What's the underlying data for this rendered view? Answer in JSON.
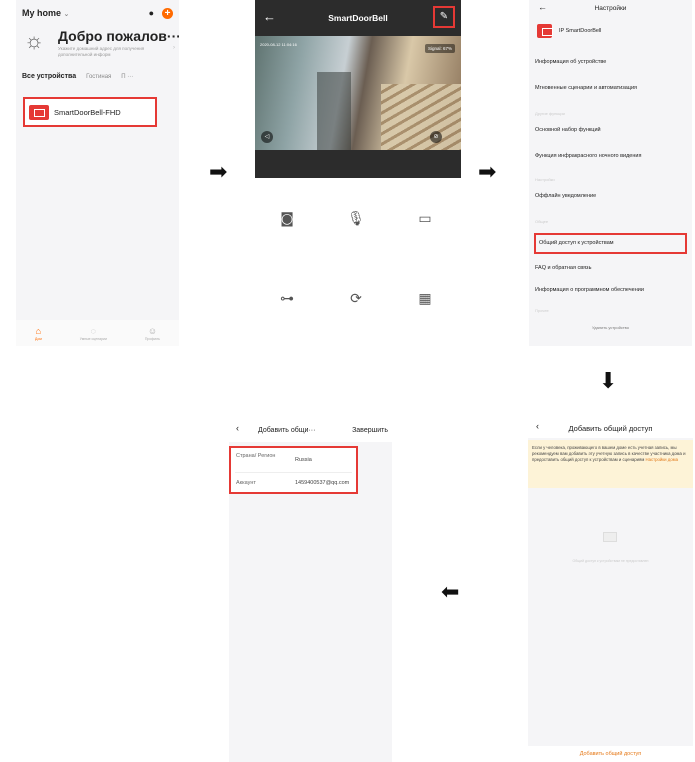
{
  "screen1": {
    "home": "My home",
    "home_chevron": "⌄",
    "mic_icon": "🎙",
    "add_icon": "+",
    "welcome": "Добро пожалов···",
    "weather_hint": "Укажите домашний адрес для получения дополнительной информ",
    "tabs": [
      "Все устройства",
      "Гостиная",
      "П ···"
    ],
    "device_name": "SmartDoorBell-FHD",
    "nav": [
      {
        "icon": "home-icon",
        "label": "Дом"
      },
      {
        "icon": "scene-icon",
        "label": "Умные сценарии"
      },
      {
        "icon": "profile-icon",
        "label": "Профиль"
      }
    ]
  },
  "screen2": {
    "title": "SmartDoorBell",
    "timestamp": "2020-08-12 11:04:16",
    "signal": "Signal: 67%"
  },
  "screen3": {
    "title": "Настройки",
    "device_name": "IP SmartDoorBell",
    "rows": [
      "Информация об устройстве",
      "Мгновенные сценарии и автоматизация",
      "Основной набор функций",
      "Функция инфракрасного ночного видения",
      "Оффлайн уведомление",
      "Общий доступ к устройствам",
      "FAQ и обратная связь",
      "Информация о программном обеспечении"
    ],
    "faint_labels": [
      "Другие функции",
      "Настройки",
      "Общее",
      "Прочее"
    ],
    "delete": "Удалить устройство"
  },
  "screen4": {
    "title": "Добавить общий доступ",
    "banner": "Если у человека, проживающего в вашем доме есть учетная запись, мы рекомендуем вам добавить эту учетную запись в качестве участника дома и предоставить общий доступ к устройствам и сценариям",
    "banner_link": "Настройки дома",
    "empty_text": "Общий доступ к устройствам не предоставлен",
    "bottom_button": "Добавить общий доступ"
  },
  "screen5": {
    "title": "Добавить общи···",
    "done": "Завершить",
    "country_label": "Страна/ Регион",
    "country_value": "Russia",
    "account_label": "Аккаунт",
    "account_value": "1459400537@qq.com"
  },
  "arrows": {
    "right": "➡",
    "down": "⬇",
    "left": "⬅"
  }
}
